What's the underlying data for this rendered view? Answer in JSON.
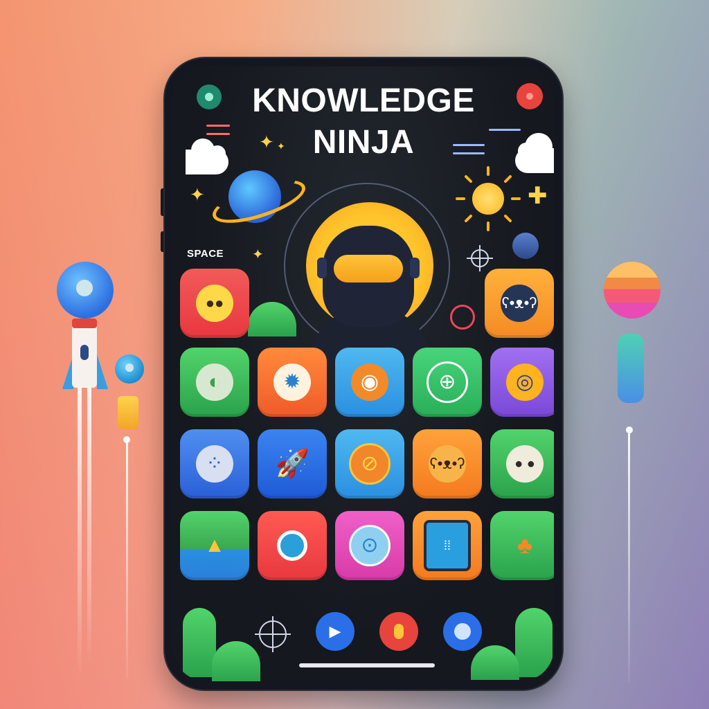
{
  "app": {
    "title_line1": "KNOWLEDGE",
    "title_line2": "NINJA",
    "space_label": "SPACE"
  },
  "colors": {
    "phone_frame": "#14171f",
    "accent_yellow": "#ffc42b",
    "text": "#ffffff"
  },
  "grid": {
    "rows": [
      [
        {
          "name": "sun-app",
          "icon": "sun-icon",
          "color": "#f0454e"
        },
        {
          "name": "bear-app",
          "icon": "bear-icon",
          "color": "#f7a12b"
        }
      ],
      [
        {
          "name": "earth-app",
          "icon": "earth-icon",
          "color": "#3fbf5a"
        },
        {
          "name": "gear-app",
          "icon": "gear-icon",
          "color": "#f26b3a"
        },
        {
          "name": "compass-app",
          "icon": "compass-icon",
          "color": "#33a8e8"
        },
        {
          "name": "globe-app",
          "icon": "globe-icon",
          "color": "#34c46a"
        },
        {
          "name": "target-app",
          "icon": "target-icon",
          "color": "#8f5ee8"
        }
      ],
      [
        {
          "name": "planet-app",
          "icon": "planet-icon",
          "color": "#3a7fe8"
        },
        {
          "name": "rocket-app",
          "icon": "rocket-icon",
          "color": "#2b6fe8"
        },
        {
          "name": "clock-app",
          "icon": "clock-icon",
          "color": "#3ba0ea"
        },
        {
          "name": "teddy-app",
          "icon": "teddy-icon",
          "color": "#f7902a"
        },
        {
          "name": "moon-app",
          "icon": "moon-icon",
          "color": "#3abf5c"
        }
      ],
      [
        {
          "name": "landscape-app",
          "icon": "landscape-icon",
          "color": "#3fbf5a"
        },
        {
          "name": "search-app",
          "icon": "search-icon",
          "color": "#f04d4d"
        },
        {
          "name": "magnifier-app",
          "icon": "magnifier-icon",
          "color": "#ea4fb8"
        },
        {
          "name": "tablet-app",
          "icon": "tablet-icon",
          "color": "#f7902a"
        },
        {
          "name": "forest-app",
          "icon": "forest-icon",
          "color": "#3fbf5a"
        }
      ]
    ]
  },
  "dock": [
    {
      "name": "crosshair-button",
      "icon": "crosshair-icon"
    },
    {
      "name": "play-button",
      "icon": "play-icon"
    },
    {
      "name": "record-button",
      "icon": "record-icon"
    },
    {
      "name": "profile-button",
      "icon": "profile-icon"
    }
  ]
}
